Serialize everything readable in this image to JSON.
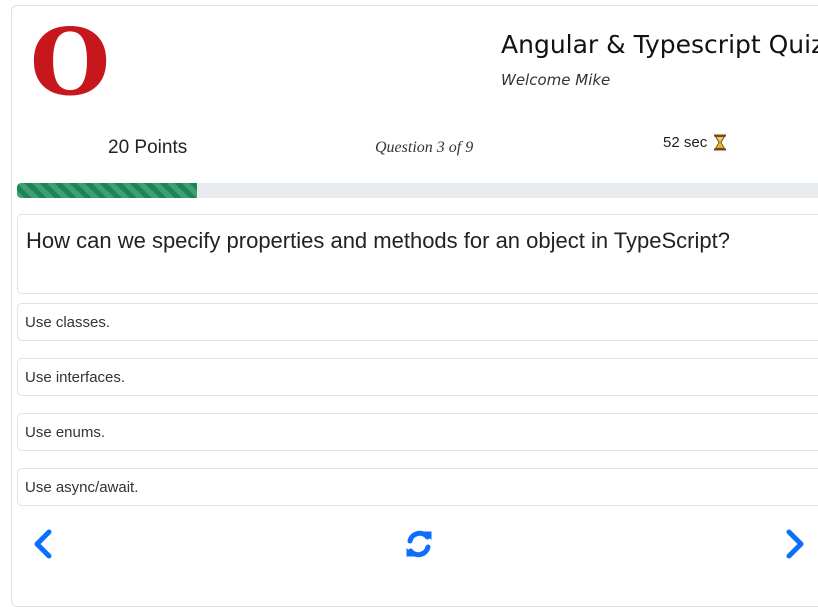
{
  "header": {
    "logo_letter": "O",
    "title": "Angular & Typescript Quiz",
    "welcome": "Welcome Mike"
  },
  "status": {
    "points": "20 Points",
    "question_counter": "Question 3 of 9",
    "timer": "52 sec",
    "timer_icon": "hourglass-icon"
  },
  "progress": {
    "fraction": 0.22,
    "color": "#198754"
  },
  "question": {
    "text": "How can we specify properties and methods for an object in TypeScript?"
  },
  "options": [
    {
      "label": "Use classes."
    },
    {
      "label": "Use interfaces."
    },
    {
      "label": "Use enums."
    },
    {
      "label": "Use async/await."
    }
  ],
  "navigation": {
    "prev_icon": "chevron-left-icon",
    "reset_icon": "refresh-icon",
    "next_icon": "chevron-right-icon",
    "icon_color": "#0d6efd"
  },
  "colors": {
    "logo": "#c8171c",
    "border": "#dee2e6"
  }
}
